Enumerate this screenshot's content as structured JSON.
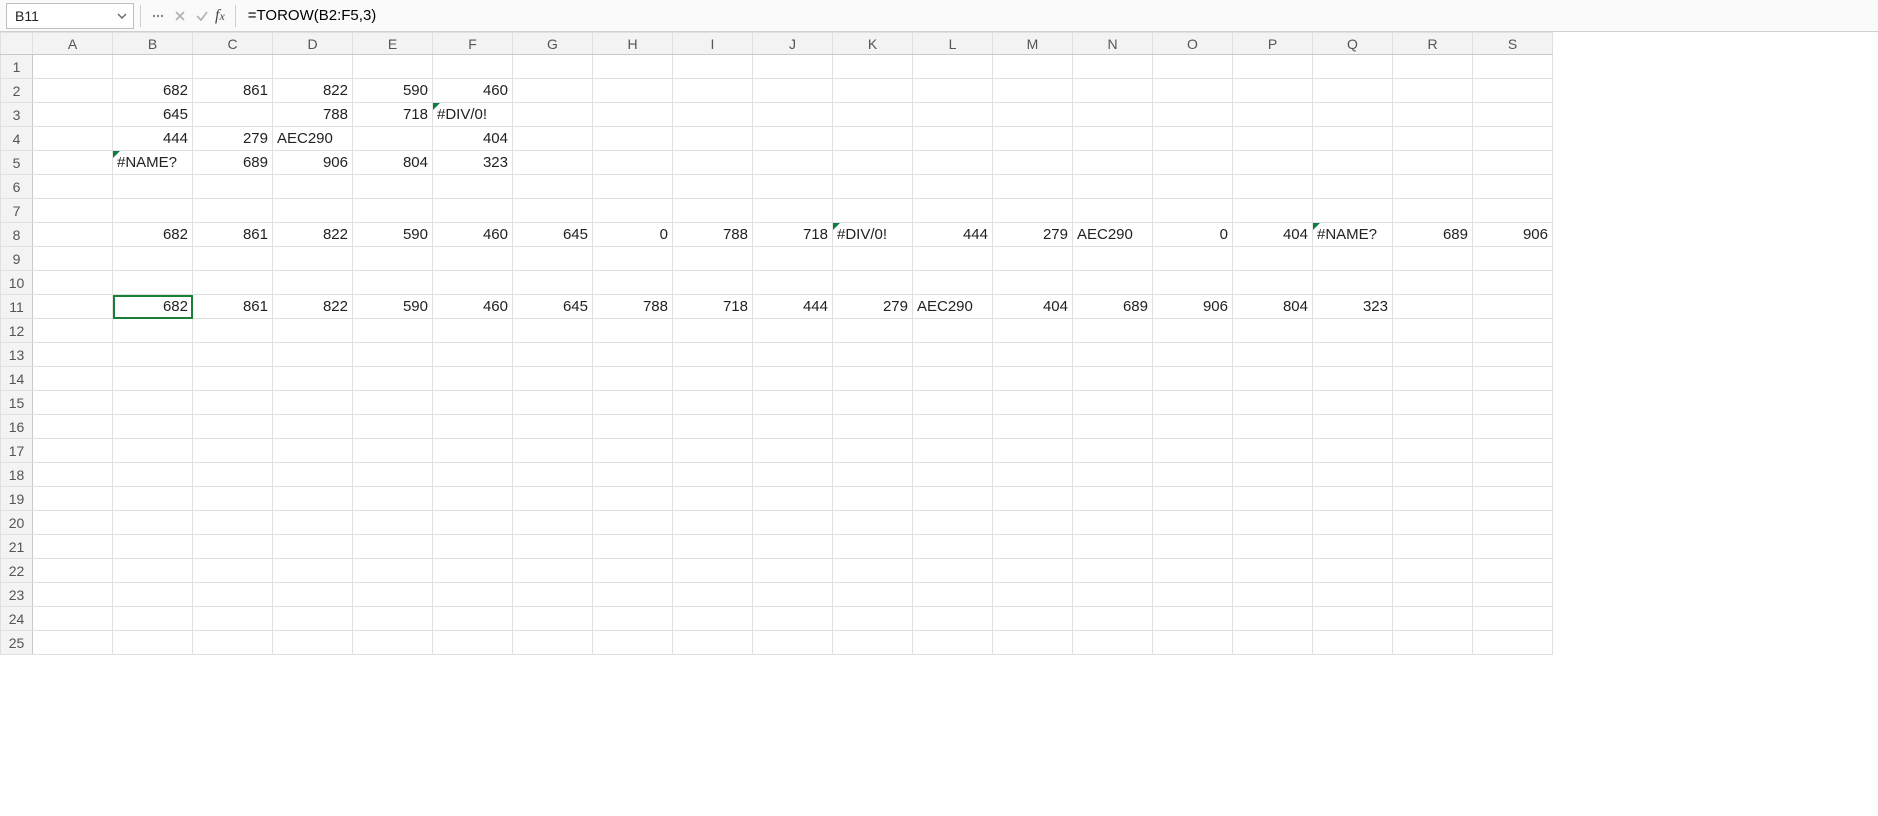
{
  "formula_bar": {
    "name_box": "B11",
    "formula": "=TOROW(B2:F5,3)"
  },
  "columns": [
    "A",
    "B",
    "C",
    "D",
    "E",
    "F",
    "G",
    "H",
    "I",
    "J",
    "K",
    "L",
    "M",
    "N",
    "O",
    "P",
    "Q",
    "R",
    "S"
  ],
  "row_count": 25,
  "selected_cell": {
    "row": 11,
    "col": "B"
  },
  "cells": {
    "B2": {
      "v": "682",
      "a": "num"
    },
    "C2": {
      "v": "861",
      "a": "num"
    },
    "D2": {
      "v": "822",
      "a": "num"
    },
    "E2": {
      "v": "590",
      "a": "num"
    },
    "F2": {
      "v": "460",
      "a": "num"
    },
    "B3": {
      "v": "645",
      "a": "num"
    },
    "D3": {
      "v": "788",
      "a": "num"
    },
    "E3": {
      "v": "718",
      "a": "num"
    },
    "F3": {
      "v": "#DIV/0!",
      "a": "txt",
      "err": true
    },
    "B4": {
      "v": "444",
      "a": "num"
    },
    "C4": {
      "v": "279",
      "a": "num"
    },
    "D4": {
      "v": "AEC290",
      "a": "txt"
    },
    "F4": {
      "v": "404",
      "a": "num"
    },
    "B5": {
      "v": "#NAME?",
      "a": "txt",
      "err": true
    },
    "C5": {
      "v": "689",
      "a": "num"
    },
    "D5": {
      "v": "906",
      "a": "num"
    },
    "E5": {
      "v": "804",
      "a": "num"
    },
    "F5": {
      "v": "323",
      "a": "num"
    },
    "B8": {
      "v": "682",
      "a": "num"
    },
    "C8": {
      "v": "861",
      "a": "num"
    },
    "D8": {
      "v": "822",
      "a": "num"
    },
    "E8": {
      "v": "590",
      "a": "num"
    },
    "F8": {
      "v": "460",
      "a": "num"
    },
    "G8": {
      "v": "645",
      "a": "num"
    },
    "H8": {
      "v": "0",
      "a": "num"
    },
    "I8": {
      "v": "788",
      "a": "num"
    },
    "J8": {
      "v": "718",
      "a": "num"
    },
    "K8": {
      "v": "#DIV/0!",
      "a": "txt",
      "err": true
    },
    "L8": {
      "v": "444",
      "a": "num"
    },
    "M8": {
      "v": "279",
      "a": "num"
    },
    "N8": {
      "v": "AEC290",
      "a": "txt"
    },
    "O8": {
      "v": "0",
      "a": "num"
    },
    "P8": {
      "v": "404",
      "a": "num"
    },
    "Q8": {
      "v": "#NAME?",
      "a": "txt",
      "err": true
    },
    "R8": {
      "v": "689",
      "a": "num"
    },
    "S8": {
      "v": "906",
      "a": "num"
    },
    "B11": {
      "v": "682",
      "a": "num"
    },
    "C11": {
      "v": "861",
      "a": "num"
    },
    "D11": {
      "v": "822",
      "a": "num"
    },
    "E11": {
      "v": "590",
      "a": "num"
    },
    "F11": {
      "v": "460",
      "a": "num"
    },
    "G11": {
      "v": "645",
      "a": "num"
    },
    "H11": {
      "v": "788",
      "a": "num"
    },
    "I11": {
      "v": "718",
      "a": "num"
    },
    "J11": {
      "v": "444",
      "a": "num"
    },
    "K11": {
      "v": "279",
      "a": "num"
    },
    "L11": {
      "v": "AEC290",
      "a": "txt"
    },
    "M11": {
      "v": "404",
      "a": "num"
    },
    "N11": {
      "v": "689",
      "a": "num"
    },
    "O11": {
      "v": "906",
      "a": "num"
    },
    "P11": {
      "v": "804",
      "a": "num"
    },
    "Q11": {
      "v": "323",
      "a": "num"
    }
  }
}
